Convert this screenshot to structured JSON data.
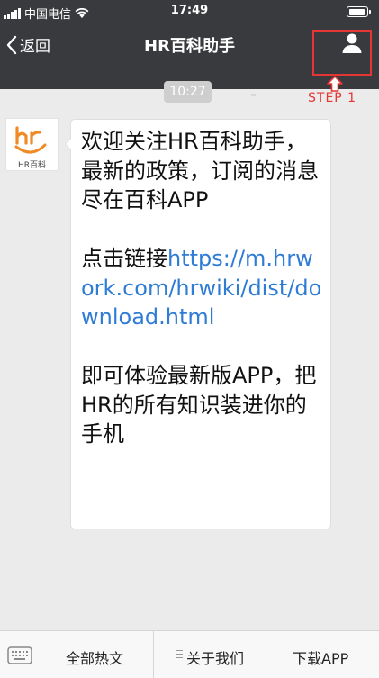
{
  "status_bar": {
    "carrier": "中国电信",
    "time": "17:49"
  },
  "nav": {
    "back_label": "返回",
    "title": "HR百科助手"
  },
  "annotation": {
    "step_label": "STEP 1",
    "color": "#e53535"
  },
  "chat": {
    "timestamp": "10:27",
    "avatar_brand": "HR百科",
    "message": {
      "p1": "欢迎关注HR百科助手，最新的政策，订阅的消息尽在百科APP",
      "p2_prefix": "点击链接",
      "p2_link": "https://m.hrwork.com/hrwiki/dist/download.html",
      "p3": "即可体验最新版APP，把HR的所有知识装进你的手机"
    }
  },
  "menu": {
    "items": [
      "全部热文",
      "关于我们",
      "下载APP"
    ]
  },
  "colors": {
    "nav_bg": "#393a3e",
    "chat_bg": "#ebebeb",
    "link": "#2f7cd6",
    "brand_orange": "#f08a24"
  }
}
